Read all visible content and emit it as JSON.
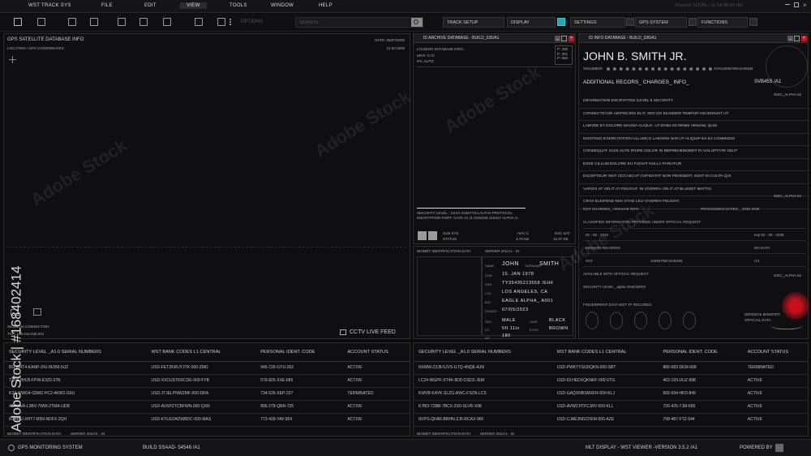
{
  "menu": {
    "app": "WST TRACK SYS",
    "items": [
      "FILE",
      "EDIT",
      "VIEW",
      "TOOLS",
      "WINDOW",
      "HELP"
    ],
    "active": "VIEW",
    "right_text": "Channel 1122AL- 11 54:38:92 /A5"
  },
  "toolbar": {
    "options_label": "OPTIONS",
    "search_placeholder": "SEARCH...",
    "buttons": [
      "TRACK SETUP",
      "DISPLAY",
      "SETTINGS",
      "GPS SYSTEM",
      "FUNCTIONS"
    ]
  },
  "gps_panel": {
    "title": "GPS SATELLITE DATABASE INFO",
    "subtitle": "LOCATION / GPS COORDINATES",
    "date": "DATE: 05/07/2035",
    "time": "21:30:3500",
    "session": "SESSION CONNECTION",
    "tcp": "TCP: 168.215.035.001",
    "live_feed": "CCTV LIVE FEED"
  },
  "archive_window": {
    "title": "ID ARCHIVE DATABASE - BUILD_035/A1",
    "loading": "LOADING DATABASE INFO...",
    "mv": "M/V#: 0.72",
    "rv": "RV: AUTO",
    "p1": "P: 205",
    "p2": "P: 301",
    "p3": "P: 558",
    "security1": "SECURITY LEVEL : XXXX 234577/44 ALPHA PROTOCOL",
    "security2": "ENCRYPTION PORT: GATE 21 /3 ASXDDD 118347 ALPHA /A",
    "sub_sys": "SUB SYS",
    "status": "STATUS",
    "hac_label": "HAC-C",
    "hac_value": "3.79 KB",
    "ksc_label": "KSC SAT",
    "ksc_value": "15.37 KB"
  },
  "biomet": {
    "title": "BIOMET IDENTIFICATION DATA",
    "server": "SERVER 201/A1 - ID",
    "name_label": "NAME",
    "name": "JOHN",
    "surname_label": "SURNAME",
    "surname": "SMITH",
    "dob_label": "DOB",
    "dob": "15. JAN 1978",
    "ssn_label": "SSN",
    "ssn": "TY35495213558 /EH6",
    "loc_label": "LOC",
    "loc": "LOS ANGELES, CA",
    "bio_label": "BIO",
    "bio": "EAGLE ALPHA_ A001",
    "issued_label": "ISSUED",
    "issued": "07/05/2023",
    "sex_label": "SEX",
    "sex": "MALE",
    "hair_label": "HAIR",
    "hair": "BLACK",
    "ht_label": "HT",
    "ht": "5ft 11in",
    "eyes_label": "EYES",
    "eyes": "BROWN",
    "wt_label": "WT",
    "wt": "180"
  },
  "info_window": {
    "title": "ID INFO DATABASE - BUILD_036/A1",
    "person": "JOHN B. SMITH JR.",
    "snumber_label": "S/NUMBER",
    "snumber": "XXX23456798ASVB455",
    "additional": "ADDITIONAL RECORS_ CHARGES_ INFO_",
    "svb": "SVB45S  /A1",
    "dec": "/DEC_ALPHA 53",
    "lines": [
      "INFORMATION ENCRYPTED /LEVEL 5 SECURITY",
      "CONSECTETUR ADIPISCING ELIT, SED DO EIUSMOD TEMPOR INCIDIDUNT UT",
      "LABORE ET DOLORE MAGNA ALIQUA. UT ENIM AD MINIM VENIAM, QUIS",
      "NOSTRUD EXERCITATION ULLAMCO LABORIS NISI UT ALIQUIP EX EA COMMODO",
      "CONSEQUAT. DUIS AUTE IRURE DOLOR IN REPREHENDERIT IN VOLUPTATE VELIT",
      "ESSE CILLUM DOLORE EU FUGIAT NULLA PARIATUR.",
      "EXCEPTEUR SINT OCCAECAT CUPIDATAT NON PROIDENT, SUNT IN CULPA QUI",
      "VARIUS AT VELIT AT FEUGIAT. IN VIVERRA VELIT AT BLANDIT MATTIS.",
      "CRAS ELEIFEND NISI VITAE LEO VIVERRA FEUGIAT."
    ],
    "dec2": "/DEC_ALPHA 53",
    "ggt": "GGT CHARGES_ ARCHIVE INFO",
    "processing": "PROCESSING DATES _ 2030-2036",
    "classified": "CLASSIFIED INFORMATION PROVIDED UNDER OFFICIAL REQUEST",
    "date1": "02 - 05 - 2033",
    "exp": "exp 02 - 05 - 2038",
    "mission": "MISSION RECORDS",
    "no_data": "NO DATA",
    "xxx": "XXX",
    "code2": "23456798ASVB455",
    "a1": "/A1",
    "official": "AVAILABLE WITH OFFICIAL REQUEST",
    "dec3": "/DEC_ALPHA 53",
    "security": "SECURITY LEVEL _alpha ONE/ZERO",
    "fingerprint": "FINGERPRINT DATA WST TF RECORDS",
    "defence": "DEFENCE MINISTRY",
    "official_data": "OFFICIAL DATA"
  },
  "tables": [
    {
      "headers": [
        "SECURITY LEVEL _A1.0 SERIAL NUMBERS",
        "WST BANK CODES L1 CENTRAL",
        "PERSONAL IDENT. CODE",
        "ACCOUNT STATUS"
      ],
      "rows": [
        [
          "BG-GRT4-KANP-Z4J-8U5M-NJZ",
          "USD-FETZKRUYJTK-000-ZMG",
          "945-726-GYU-262",
          "ACTIVE"
        ],
        [
          "TZN5-BHJ5-FPW-E3Z0-37N",
          "USD-XXCUSTKRCDE-000-FYB",
          "579-825-XXE-685",
          "ACTIVE"
        ],
        [
          "K3Z-WWD4-G5MZ-HC2-4KW2-G6U",
          "USD-JTJELPNWZMF-000-DRA",
          "734-526-XEP-227",
          "TERMINATED"
        ],
        [
          "X5-NJVA-L3BV-7WW-2TMA-UDB",
          "USD-AVXPZTCBFWN-000-QXN",
          "895-278-QBR-725",
          "ACTIVE"
        ],
        [
          "R3-B5U-XHT7-R5N-NDFX-2QH",
          "USD-KYLEOADWBDC-000-MAS",
          "773-439-YAY-954",
          "ACTIVE"
        ]
      ]
    },
    {
      "headers": [
        "SECURITY LEVEL _A1.0 SERIAL NUMBERS",
        "WST BANK CODES L1 CENTRAL",
        "PERSONAL IDENT. CODE",
        "ACCOUNT STATUS"
      ],
      "rows": [
        [
          "NXMW-Z3J8-5JVS-GTQ-4NQE-AJN",
          "USD-PWKTYSUDQKN-000-SBT",
          "886-683-DEM-668",
          "TERMINATED"
        ],
        [
          "LC24-WGPF-XT4K-8DD-DSD2-JEM",
          "USD-DLHEDXQKNKF-000-VTG",
          "462-193-UUZ-998",
          "ACTIVE"
        ],
        [
          "KWVB-KAYK-SLZG-RWC-FSZN-LCS",
          "USD-GAQSNBSMXFR-000-KLJ",
          "665-694-HFD-849",
          "ACTIVE"
        ],
        [
          "K7BO-72BB-7BCX-ZX0-SLVR-X98",
          "USD-AVWCHTFCJRV-000-KLL",
          "726-426-TJM-656",
          "ACTIVE"
        ],
        [
          "NVPS-QFAR-BRHN-ZJ6-RCAX-96F",
          "USD-CJAEJNGCFEM-000-AZE",
          "798-487-FTZ-544",
          "ACTIVE"
        ]
      ]
    }
  ],
  "table_footer": {
    "left": "BIOMET IDENTIFICATION DATA",
    "mid": "SERVER 201/A1 - ID"
  },
  "statusbar": {
    "left": "GPS MONITORING SYSTEM",
    "build": "BUILD SSAAD- 54546 /A1",
    "version": "MLT DISPLAY - WST VIEWER -VERSION 3.5.2 /A1",
    "powered": "POWERED BY"
  },
  "watermark": {
    "text": "Adobe Stock",
    "id": "#168402414"
  },
  "colors": {
    "accent_cyan": "#25a7b5",
    "close_red": "#b01d22",
    "stamp_red": "#c8101c"
  }
}
